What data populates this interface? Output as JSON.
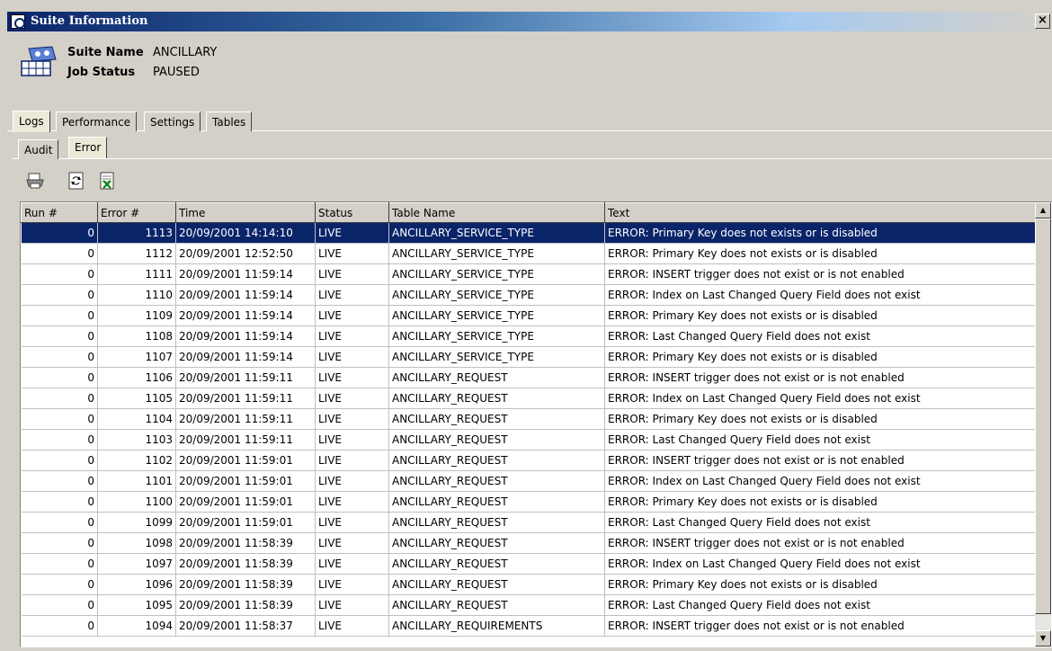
{
  "window": {
    "title": "Suite Information",
    "close_glyph": "×"
  },
  "info": {
    "suite_name_label": "Suite Name",
    "suite_name_value": "ANCILLARY",
    "job_status_label": "Job Status",
    "job_status_value": "PAUSED"
  },
  "tabs": [
    "Logs",
    "Performance",
    "Settings",
    "Tables"
  ],
  "subtabs": [
    "Audit",
    "Error"
  ],
  "toolbar": [
    "print-icon",
    "refresh-icon",
    "export-icon"
  ],
  "grid": {
    "columns": [
      "Run #",
      "Error #",
      "Time",
      "Status",
      "Table Name",
      "Text"
    ],
    "rows": [
      [
        "0",
        "1113",
        "20/09/2001 14:14:10",
        "LIVE",
        "ANCILLARY_SERVICE_TYPE",
        "ERROR: Primary Key does not exists or is disabled"
      ],
      [
        "0",
        "1112",
        "20/09/2001 12:52:50",
        "LIVE",
        "ANCILLARY_SERVICE_TYPE",
        "ERROR: Primary Key does not exists or is disabled"
      ],
      [
        "0",
        "1111",
        "20/09/2001 11:59:14",
        "LIVE",
        "ANCILLARY_SERVICE_TYPE",
        "ERROR: INSERT trigger does not exist or is not enabled"
      ],
      [
        "0",
        "1110",
        "20/09/2001 11:59:14",
        "LIVE",
        "ANCILLARY_SERVICE_TYPE",
        "ERROR: Index on Last Changed Query Field does not exist"
      ],
      [
        "0",
        "1109",
        "20/09/2001 11:59:14",
        "LIVE",
        "ANCILLARY_SERVICE_TYPE",
        "ERROR: Primary Key does not exists or is disabled"
      ],
      [
        "0",
        "1108",
        "20/09/2001 11:59:14",
        "LIVE",
        "ANCILLARY_SERVICE_TYPE",
        "ERROR: Last Changed Query Field does not exist"
      ],
      [
        "0",
        "1107",
        "20/09/2001 11:59:14",
        "LIVE",
        "ANCILLARY_SERVICE_TYPE",
        "ERROR: Primary Key does not exists or is disabled"
      ],
      [
        "0",
        "1106",
        "20/09/2001 11:59:11",
        "LIVE",
        "ANCILLARY_REQUEST",
        "ERROR: INSERT trigger does not exist or is not enabled"
      ],
      [
        "0",
        "1105",
        "20/09/2001 11:59:11",
        "LIVE",
        "ANCILLARY_REQUEST",
        "ERROR: Index on Last Changed Query Field does not exist"
      ],
      [
        "0",
        "1104",
        "20/09/2001 11:59:11",
        "LIVE",
        "ANCILLARY_REQUEST",
        "ERROR: Primary Key does not exists or is disabled"
      ],
      [
        "0",
        "1103",
        "20/09/2001 11:59:11",
        "LIVE",
        "ANCILLARY_REQUEST",
        "ERROR: Last Changed Query Field does not exist"
      ],
      [
        "0",
        "1102",
        "20/09/2001 11:59:01",
        "LIVE",
        "ANCILLARY_REQUEST",
        "ERROR: INSERT trigger does not exist or is not enabled"
      ],
      [
        "0",
        "1101",
        "20/09/2001 11:59:01",
        "LIVE",
        "ANCILLARY_REQUEST",
        "ERROR: Index on Last Changed Query Field does not exist"
      ],
      [
        "0",
        "1100",
        "20/09/2001 11:59:01",
        "LIVE",
        "ANCILLARY_REQUEST",
        "ERROR: Primary Key does not exists or is disabled"
      ],
      [
        "0",
        "1099",
        "20/09/2001 11:59:01",
        "LIVE",
        "ANCILLARY_REQUEST",
        "ERROR: Last Changed Query Field does not exist"
      ],
      [
        "0",
        "1098",
        "20/09/2001 11:58:39",
        "LIVE",
        "ANCILLARY_REQUEST",
        "ERROR: INSERT trigger does not exist or is not enabled"
      ],
      [
        "0",
        "1097",
        "20/09/2001 11:58:39",
        "LIVE",
        "ANCILLARY_REQUEST",
        "ERROR: Index on Last Changed Query Field does not exist"
      ],
      [
        "0",
        "1096",
        "20/09/2001 11:58:39",
        "LIVE",
        "ANCILLARY_REQUEST",
        "ERROR: Primary Key does not exists or is disabled"
      ],
      [
        "0",
        "1095",
        "20/09/2001 11:58:39",
        "LIVE",
        "ANCILLARY_REQUEST",
        "ERROR: Last Changed Query Field does not exist"
      ],
      [
        "0",
        "1094",
        "20/09/2001 11:58:37",
        "LIVE",
        "ANCILLARY_REQUIREMENTS",
        "ERROR: INSERT trigger does not exist or is not enabled"
      ]
    ]
  },
  "scrollbar": {
    "up_glyph": "▲",
    "down_glyph": "▼"
  }
}
